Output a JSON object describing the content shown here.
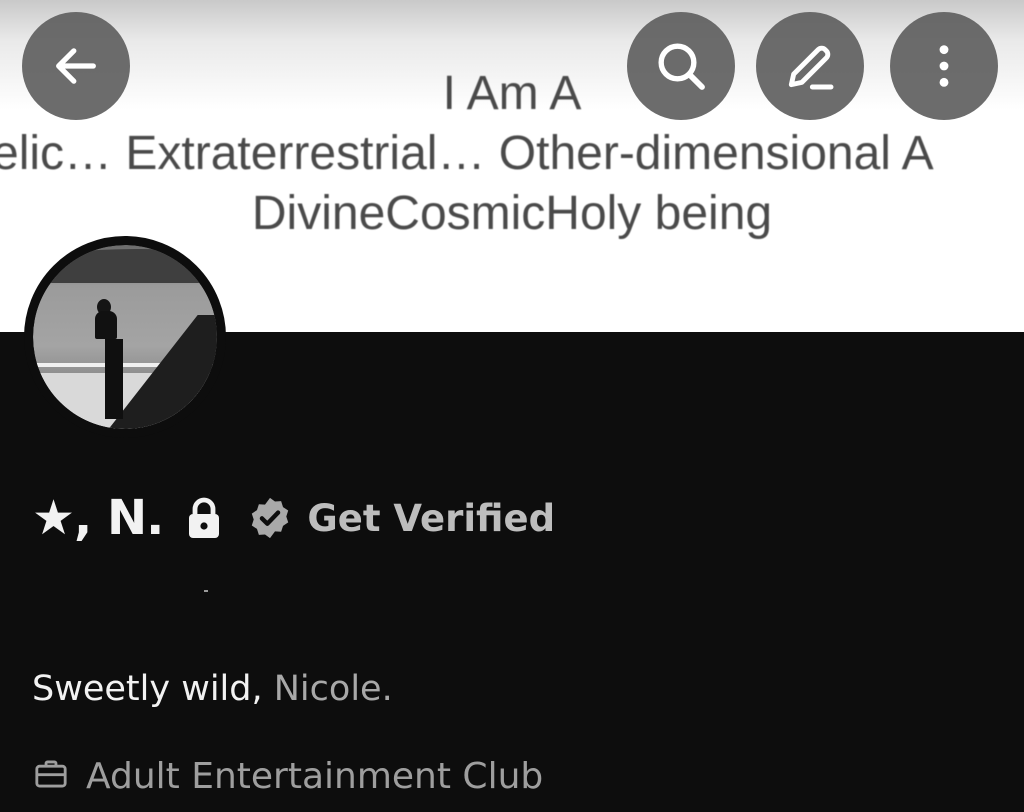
{
  "banner": {
    "line1": "I Am A",
    "line2": "elic… Extraterrestrial… Other-dimensional A",
    "line3": "DivineCosmicHoly being"
  },
  "header": {
    "back_icon": "arrow-left-icon",
    "search_icon": "search-icon",
    "edit_icon": "pencil-icon",
    "more_icon": "more-vertical-icon"
  },
  "profile": {
    "display_name": "★, N.",
    "protected_icon": "lock-icon",
    "verified_badge_icon": "verified-badge-icon",
    "get_verified_label": "Get Verified",
    "bio_part1": "Sweetly wild,",
    "bio_part2": " Nicole.",
    "category_icon": "briefcase-icon",
    "category": "Adult Entertainment Club"
  },
  "colors": {
    "background": "#0d0d0d",
    "button_bg": "#5f5f5f",
    "text_primary": "#f2f2f2",
    "text_secondary": "#9e9e9e"
  }
}
